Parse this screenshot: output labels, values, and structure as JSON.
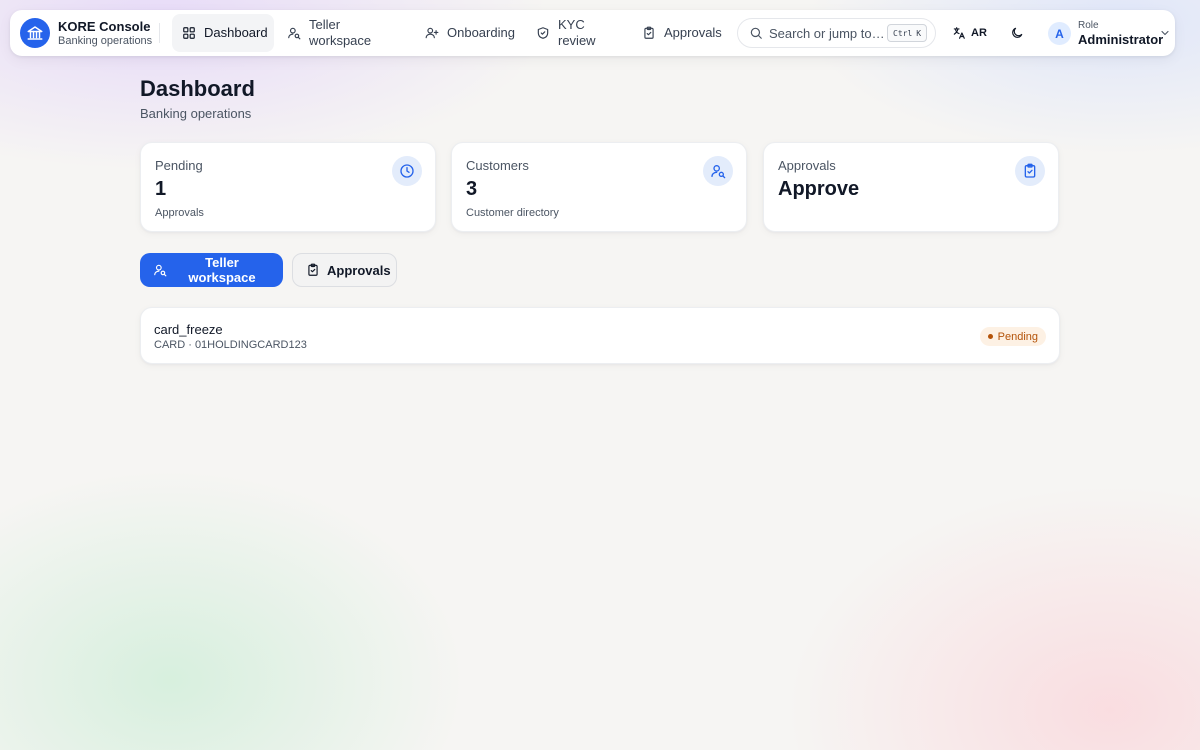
{
  "brand": {
    "name": "KORE Console",
    "subtitle": "Banking operations",
    "icon": "bank-icon"
  },
  "nav": {
    "items": [
      {
        "label": "Dashboard",
        "icon": "grid-icon",
        "active": true
      },
      {
        "label": "Teller workspace",
        "icon": "user-search-icon",
        "active": false
      },
      {
        "label": "Onboarding",
        "icon": "user-plus-icon",
        "active": false
      },
      {
        "label": "KYC review",
        "icon": "shield-check-icon",
        "active": false
      },
      {
        "label": "Approvals",
        "icon": "clipboard-check-icon",
        "active": false
      }
    ]
  },
  "search": {
    "placeholder": "Search or jump to…",
    "shortcut_mod": "Ctrl",
    "shortcut_key": "K"
  },
  "language": {
    "label": "AR",
    "icon": "translate-icon"
  },
  "theme": {
    "icon": "moon-icon"
  },
  "user": {
    "initial": "A",
    "role_label": "Role",
    "role_value": "Administrator"
  },
  "page": {
    "title": "Dashboard",
    "subtitle": "Banking operations"
  },
  "stats": [
    {
      "label": "Pending",
      "value": "1",
      "description": "Approvals",
      "icon": "clock-icon"
    },
    {
      "label": "Customers",
      "value": "3",
      "description": "Customer directory",
      "icon": "user-search-icon"
    },
    {
      "label": "Approvals",
      "value": "Approve",
      "description": "",
      "icon": "clipboard-check-icon"
    }
  ],
  "actions": {
    "primary": {
      "label": "Teller workspace",
      "icon": "user-search-icon"
    },
    "secondary": {
      "label": "Approvals",
      "icon": "clipboard-check-icon"
    }
  },
  "approvals": [
    {
      "title": "card_freeze",
      "meta": "CARD · 01HOLDINGCARD123",
      "status": "Pending"
    }
  ],
  "colors": {
    "accent": "#2563eb",
    "pending_text": "#b45309",
    "pending_bg": "#fdf1e4",
    "icon_bg": "#e3ecfb"
  }
}
